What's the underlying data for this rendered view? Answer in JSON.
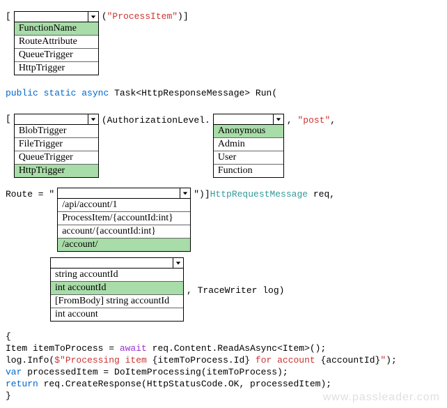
{
  "line1": {
    "open": "[",
    "quoted": "\"ProcessItem\"",
    "close": ")]"
  },
  "dropdown1": {
    "options": [
      "FunctionName",
      "RouteAttribute",
      "QueueTrigger",
      "HttpTrigger"
    ],
    "selectedIndex": 0
  },
  "line2": {
    "kw1": "public",
    "kw2": "static",
    "kw3": "async",
    "rest": " Task<HttpResponseMessage> Run("
  },
  "line3": {
    "open": "[",
    "authLevel": "(AuthorizationLevel.",
    "comma": ",",
    "post": "\"post\"",
    "closeComma": ","
  },
  "dropdown2": {
    "options": [
      "BlobTrigger",
      "FileTrigger",
      "QueueTrigger",
      "HttpTrigger"
    ],
    "selectedIndex": 3
  },
  "dropdown3": {
    "options": [
      "Anonymous",
      "Admin",
      "User",
      "Function"
    ],
    "selectedIndex": 0
  },
  "line4": {
    "route": "Route = \"",
    "closeParen": "\")]",
    "httpReq": "HttpRequestMessage",
    "reqComma": " req,"
  },
  "dropdown4": {
    "options": [
      "/api/account/1",
      "ProcessItem/{accountId:int}",
      "account/{accountId:int}",
      "/account/"
    ],
    "selectedIndex": 3
  },
  "dropdown5": {
    "options": [
      "string accountId",
      "int accountId",
      "[FromBody] string accountId",
      "int account"
    ],
    "selectedIndex": 1
  },
  "line5": {
    "trace": ", TraceWriter log)"
  },
  "codeBlock": {
    "l1": "{",
    "l2a": "Item itemToProcess = ",
    "l2b": "await",
    "l2c": " req.Content.ReadAsAsync<Item>();",
    "l3a": "log.Info(",
    "l3b": "$\"Processing item ",
    "l3c": "{itemToProcess.Id}",
    "l3d": " for account ",
    "l3e": "{accountId}",
    "l3f": "\"",
    "l3g": ");",
    "l4a": "var",
    "l4b": " processedItem = DoItemProcessing(itemToProcess);",
    "l5a": "return",
    "l5b": " req.CreateResponse(HttpStatusCode.OK, processedItem);",
    "l6": "}"
  },
  "watermark": "www.passleader.com"
}
